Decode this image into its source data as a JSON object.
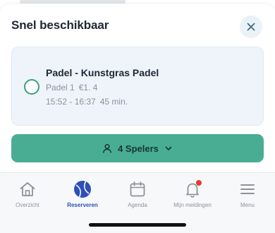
{
  "sheet": {
    "title": "Snel beschikbaar",
    "close_icon": "close-icon"
  },
  "slot": {
    "title": "Padel - Kunstgras Padel",
    "court": "Padel 1",
    "price": "€1. 4",
    "time": "15:52 - 16:37",
    "duration": "45 min.",
    "selected": false
  },
  "players": {
    "label": "4 Spelers",
    "icon": "user-icon",
    "chevron": "chevron-down-icon"
  },
  "tabs": [
    {
      "label": "Overzicht",
      "icon": "home-icon",
      "active": false
    },
    {
      "label": "Reserveren",
      "icon": "padel-ball-icon",
      "active": true
    },
    {
      "label": "Agenda",
      "icon": "calendar-icon",
      "active": false
    },
    {
      "label": "Mijn meldingen",
      "icon": "bell-icon",
      "active": false,
      "badge": true
    },
    {
      "label": "Menu",
      "icon": "menu-icon",
      "active": false
    }
  ],
  "colors": {
    "accent_green": "#48ad93",
    "active_tab": "#2d4fb8",
    "card_bg": "#eef4fa",
    "badge_red": "#e53935"
  }
}
